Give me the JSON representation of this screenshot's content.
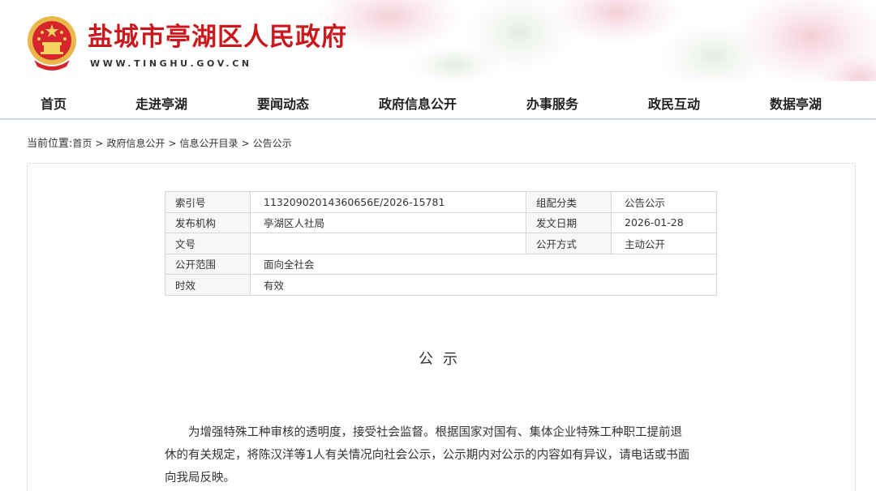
{
  "header": {
    "title": "盐城市亭湖区人民政府",
    "url": "WWW.TINGHU.GOV.CN"
  },
  "nav": {
    "items": [
      "首页",
      "走进亭湖",
      "要闻动态",
      "政府信息公开",
      "办事服务",
      "政民互动",
      "数据亭湖"
    ]
  },
  "breadcrumb": {
    "prefix": "当前位置:",
    "items": [
      "首页",
      "政府信息公开",
      "信息公开目录",
      "公告公示"
    ],
    "separator": ">"
  },
  "meta": {
    "rows": [
      {
        "label": "索引号",
        "value": "11320902014360656E/2026-15781",
        "label2": "组配分类",
        "value2": "公告公示"
      },
      {
        "label": "发布机构",
        "value": "亭湖区人社局",
        "label2": "发文日期",
        "value2": "2026-01-28"
      },
      {
        "label": "文号",
        "value": "",
        "label2": "公开方式",
        "value2": "主动公开"
      },
      {
        "label": "公开范围",
        "value": "面向全社会"
      },
      {
        "label": "时效",
        "value": "有效"
      }
    ]
  },
  "document": {
    "title": "公示",
    "body": "为增强特殊工种审核的透明度，接受社会监督。根据国家对国有、集体企业特殊工种职工提前退休的有关规定，将陈汉洋等1人有关情况向社会公示，公示期内对公示的内容如有异议，请电话或书面向我局反映。"
  },
  "colors": {
    "brand_red": "#c9191e",
    "emblem_gold": "#e8b84a",
    "nav_border": "#c9d6e6"
  },
  "icons": [
    "national-emblem-icon"
  ]
}
